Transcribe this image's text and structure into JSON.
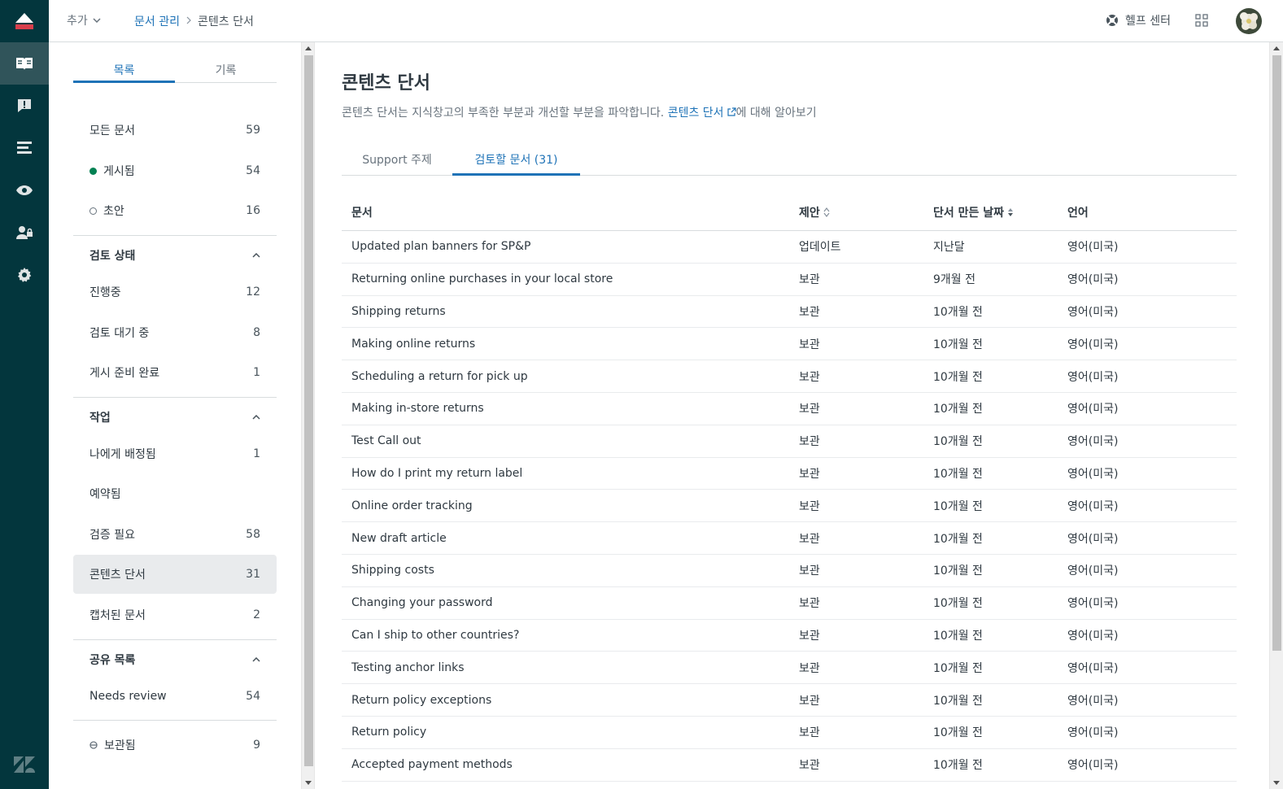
{
  "header": {
    "add_label": "추가",
    "breadcrumb": {
      "parent": "문서 관리",
      "current": "콘텐츠 단서"
    },
    "help_label": "헬프 센터"
  },
  "sidebar": {
    "tabs": [
      "목록",
      "기록"
    ],
    "items": [
      {
        "label": "모든 문서",
        "count": "59"
      },
      {
        "label": "게시됨",
        "count": "54"
      },
      {
        "label": "초안",
        "count": "16"
      }
    ],
    "review_status": {
      "title": "검토 상태",
      "items": [
        {
          "label": "진행중",
          "count": "12"
        },
        {
          "label": "검토 대기 중",
          "count": "8"
        },
        {
          "label": "게시 준비 완료",
          "count": "1"
        }
      ]
    },
    "tasks": {
      "title": "작업",
      "items": [
        {
          "label": "나에게 배정됨",
          "count": "1"
        },
        {
          "label": "예약됨",
          "count": ""
        },
        {
          "label": "검증 필요",
          "count": "58"
        },
        {
          "label": "콘텐츠 단서",
          "count": "31"
        },
        {
          "label": "캡처된 문서",
          "count": "2"
        }
      ]
    },
    "shared": {
      "title": "공유 목록",
      "items": [
        {
          "label": "Needs review",
          "count": "54"
        }
      ]
    },
    "archived": {
      "label": "보관됨",
      "count": "9"
    }
  },
  "main": {
    "title": "콘텐츠 단서",
    "desc_prefix": "콘텐츠 단서는 지식창고의 부족한 부분과 개선할 부분을 파악합니다. ",
    "desc_link": "콘텐츠 단서",
    "desc_suffix": "에 대해 알아보기",
    "tabs": [
      "Support 주제",
      "검토할 문서 (31)"
    ],
    "columns": [
      "문서",
      "제안",
      "단서 만든 날짜",
      "언어"
    ],
    "rows": [
      {
        "doc": "Updated plan banners for SP&P",
        "suggestion": "업데이트",
        "date": "지난달",
        "lang": "영어(미국)"
      },
      {
        "doc": "Returning online purchases in your local store",
        "suggestion": "보관",
        "date": "9개월 전",
        "lang": "영어(미국)"
      },
      {
        "doc": "Shipping returns",
        "suggestion": "보관",
        "date": "10개월 전",
        "lang": "영어(미국)"
      },
      {
        "doc": "Making online returns",
        "suggestion": "보관",
        "date": "10개월 전",
        "lang": "영어(미국)"
      },
      {
        "doc": "Scheduling a return for pick up",
        "suggestion": "보관",
        "date": "10개월 전",
        "lang": "영어(미국)"
      },
      {
        "doc": "Making in-store returns",
        "suggestion": "보관",
        "date": "10개월 전",
        "lang": "영어(미국)"
      },
      {
        "doc": "Test Call out",
        "suggestion": "보관",
        "date": "10개월 전",
        "lang": "영어(미국)"
      },
      {
        "doc": "How do I print my return label",
        "suggestion": "보관",
        "date": "10개월 전",
        "lang": "영어(미국)"
      },
      {
        "doc": "Online order tracking",
        "suggestion": "보관",
        "date": "10개월 전",
        "lang": "영어(미국)"
      },
      {
        "doc": "New draft article",
        "suggestion": "보관",
        "date": "10개월 전",
        "lang": "영어(미국)"
      },
      {
        "doc": "Shipping costs",
        "suggestion": "보관",
        "date": "10개월 전",
        "lang": "영어(미국)"
      },
      {
        "doc": "Changing your password",
        "suggestion": "보관",
        "date": "10개월 전",
        "lang": "영어(미국)"
      },
      {
        "doc": "Can I ship to other countries?",
        "suggestion": "보관",
        "date": "10개월 전",
        "lang": "영어(미국)"
      },
      {
        "doc": "Testing anchor links",
        "suggestion": "보관",
        "date": "10개월 전",
        "lang": "영어(미국)"
      },
      {
        "doc": "Return policy exceptions",
        "suggestion": "보관",
        "date": "10개월 전",
        "lang": "영어(미국)"
      },
      {
        "doc": "Return policy",
        "suggestion": "보관",
        "date": "10개월 전",
        "lang": "영어(미국)"
      },
      {
        "doc": "Accepted payment methods",
        "suggestion": "보관",
        "date": "10개월 전",
        "lang": "영어(미국)"
      }
    ]
  },
  "colors": {
    "rail": "#03363d",
    "accent": "#1f73b7",
    "published": "#038153",
    "logo": "#d93f4c"
  }
}
